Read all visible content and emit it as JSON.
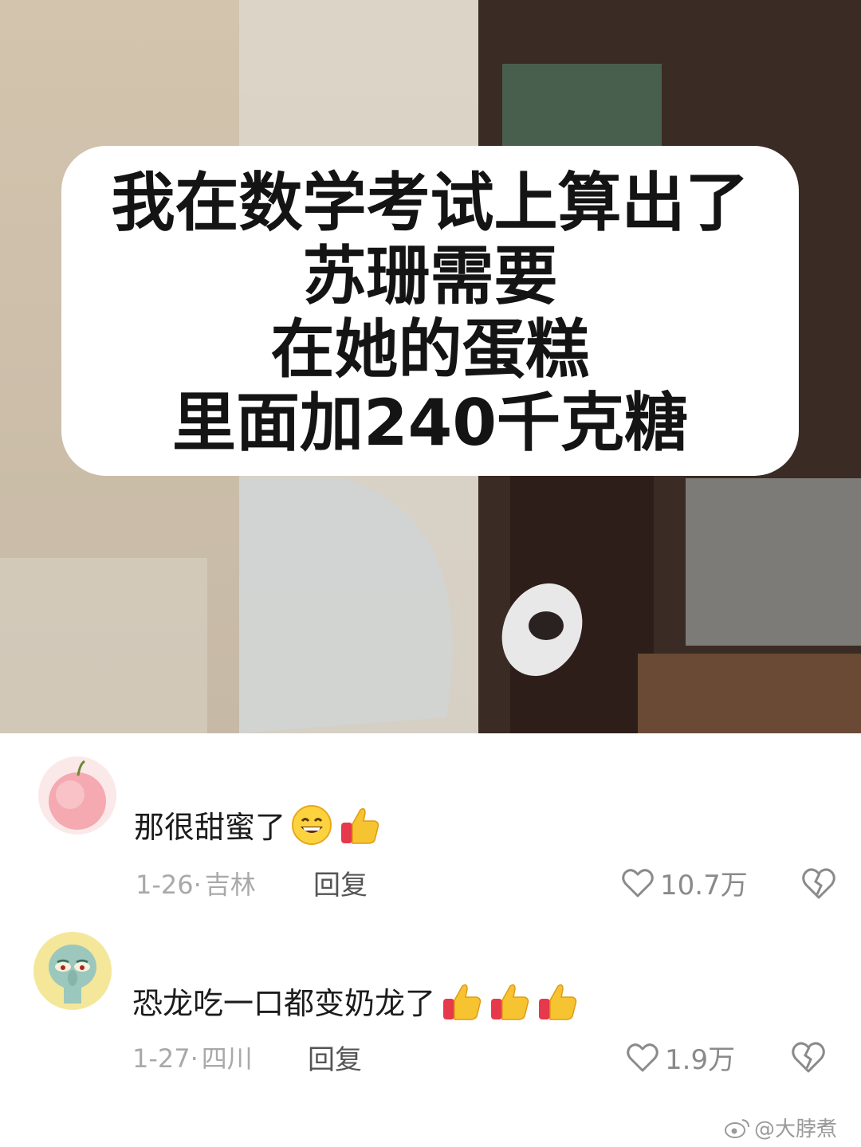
{
  "caption": {
    "lines": [
      "我在数学考试上算出了",
      "苏珊需要",
      "在她的蛋糕",
      "里面加240千克糖"
    ]
  },
  "comments": [
    {
      "avatar": "apple-avatar",
      "text": "那很甜蜜了",
      "emojis": [
        "grinning-face-emoji",
        "thumbs-up-emoji"
      ],
      "date": "1-26",
      "separator": "·",
      "location": "吉林",
      "reply_label": "回复",
      "likes": "10.7万"
    },
    {
      "avatar": "squidward-avatar",
      "text": "恐龙吃一口都变奶龙了",
      "emojis": [
        "thumbs-up-emoji",
        "thumbs-up-emoji",
        "thumbs-up-emoji"
      ],
      "date": "1-27",
      "separator": "·",
      "location": "四川",
      "reply_label": "回复",
      "likes": "1.9万"
    }
  ],
  "watermark": {
    "icon": "weibo-icon",
    "text": "@大脖煮"
  },
  "colors": {
    "caption_text": "#141414",
    "like_heart": "#8a8a8a",
    "thumb": "#f6c431",
    "thumb_cuff": "#e6394b"
  }
}
